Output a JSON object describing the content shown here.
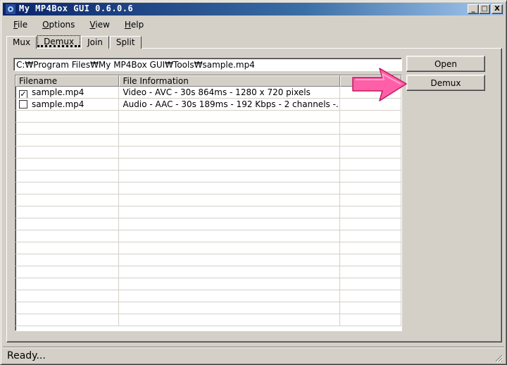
{
  "window": {
    "title": "My MP4Box GUI 0.6.0.6",
    "controls": {
      "minimize": "_",
      "maximize": "□",
      "close": "X"
    }
  },
  "menu": {
    "items": [
      "File",
      "Options",
      "View",
      "Help"
    ],
    "mnemonics": [
      "F",
      "O",
      "V",
      "H"
    ]
  },
  "tabs": [
    {
      "label": "Mux"
    },
    {
      "label": "Demux",
      "active": true
    },
    {
      "label": "Join"
    },
    {
      "label": "Split"
    }
  ],
  "demux": {
    "file_path": "C:₩Program Files₩My MP4Box GUI₩Tools₩sample.mp4",
    "columns": [
      "Filename",
      "File Information",
      ""
    ],
    "rows": [
      {
        "checked": true,
        "filename": "sample.mp4",
        "info": "Video - AVC - 30s 864ms - 1280 x 720 pixels"
      },
      {
        "checked": false,
        "filename": "sample.mp4",
        "info": "Audio - AAC - 30s 189ms - 192 Kbps - 2 channels -..."
      }
    ],
    "empty_rows": 18,
    "open_label": "Open",
    "demux_label": "Demux"
  },
  "annotation": {
    "arrow_color": "#ff5fa8"
  },
  "status": {
    "text": "Ready..."
  }
}
